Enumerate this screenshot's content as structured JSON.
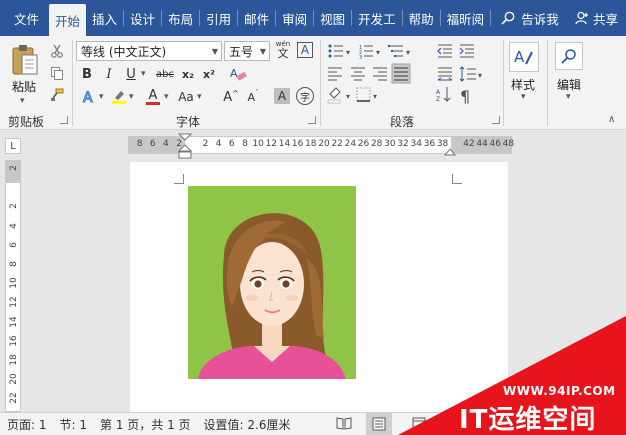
{
  "menubar": {
    "tabs": [
      "文件",
      "开始",
      "插入",
      "设计",
      "布局",
      "引用",
      "邮件",
      "审阅",
      "视图",
      "开发工",
      "帮助",
      "福昕阅"
    ],
    "active_tab": "开始",
    "tell_me": "告诉我",
    "share": "共享"
  },
  "ribbon": {
    "clipboard": {
      "paste_label": "粘贴",
      "group_label": "剪贴板"
    },
    "font": {
      "font_name": "等线 (中文正文)",
      "font_size": "五号",
      "wen_top": "wén",
      "wen_bottom": "文",
      "boxed_a": "A",
      "bold": "B",
      "italic": "I",
      "underline": "U",
      "strike": "abc",
      "sub": "x₂",
      "sup": "x²",
      "font_color_a": "A",
      "aa_label": "Aa",
      "grow": "A",
      "shrink": "A",
      "shade_a": "A",
      "circle_char": "字",
      "group_label": "字体"
    },
    "paragraph": {
      "group_label": "段落"
    },
    "styles": {
      "label": "样式"
    },
    "editing": {
      "label": "编辑"
    }
  },
  "ruler": {
    "numbers": [
      "8",
      "6",
      "4",
      "2",
      "",
      "2",
      "4",
      "6",
      "8",
      "10",
      "12",
      "14",
      "16",
      "18",
      "20",
      "22",
      "24",
      "26",
      "28",
      "30",
      "32",
      "34",
      "36",
      "38",
      "",
      "42",
      "44",
      "46",
      "48"
    ],
    "vertical_numbers": [
      "2",
      "",
      "2",
      "4",
      "6",
      "8",
      "10",
      "12",
      "14",
      "16",
      "18",
      "20",
      "22"
    ]
  },
  "status": {
    "page": "页面: 1",
    "section": "节: 1",
    "pages": "第 1 页，共 1 页",
    "setting": "设置值: 2.6厘米"
  },
  "watermark": {
    "url": "WWW.94IP.COM",
    "brand": "IT运维空间"
  },
  "colors": {
    "menubar": "#2b579a",
    "photo_bg": "#8fc447",
    "watermark": "#e8141c",
    "font_color": "#d32f2f",
    "highlight": "#ffff00"
  }
}
